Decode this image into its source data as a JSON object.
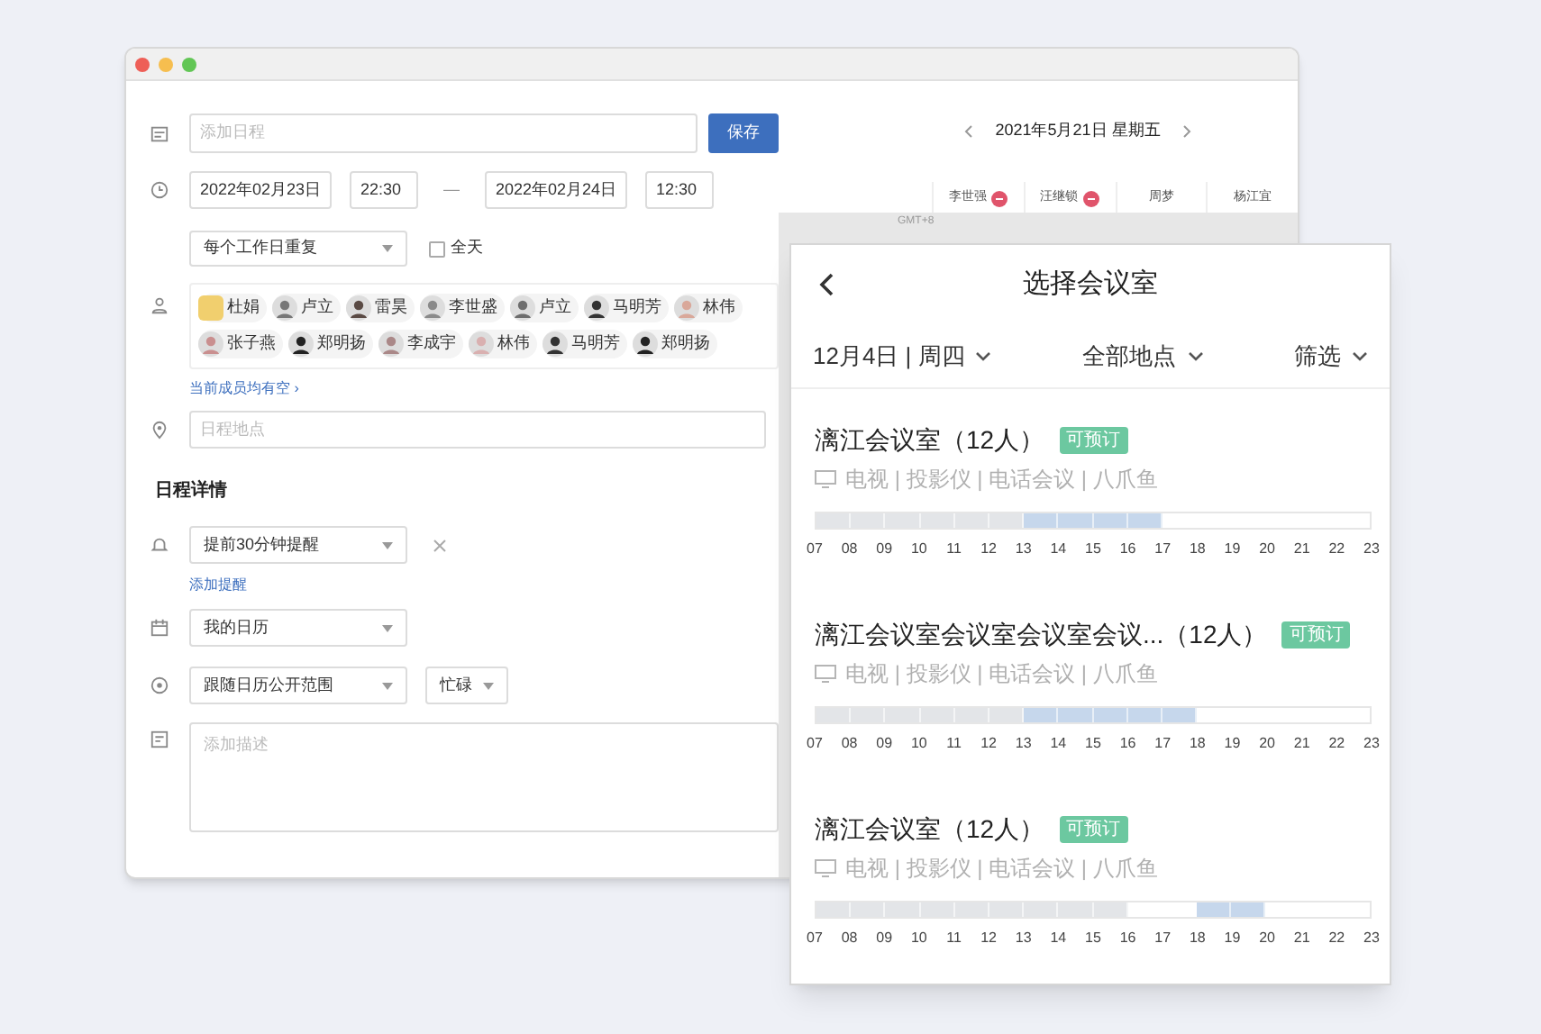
{
  "form": {
    "title_placeholder": "添加日程",
    "save_button": "保存",
    "start_date": "2022年02月23日",
    "start_time": "22:30",
    "dash": "—",
    "end_date": "2022年02月24日",
    "end_time": "12:30",
    "repeat": "每个工作日重复",
    "all_day": {
      "label": "全天",
      "checked": false
    },
    "attendees": [
      {
        "name": "杜娟",
        "kind": "square"
      },
      {
        "name": "卢立",
        "kind": "round"
      },
      {
        "name": "雷昊",
        "kind": "round"
      },
      {
        "name": "李世盛",
        "kind": "round"
      },
      {
        "name": "卢立",
        "kind": "round"
      },
      {
        "name": "马明芳",
        "kind": "round"
      },
      {
        "name": "林伟",
        "kind": "round"
      },
      {
        "name": "张子燕",
        "kind": "round"
      },
      {
        "name": "郑明扬",
        "kind": "round"
      },
      {
        "name": "李成宇",
        "kind": "round"
      },
      {
        "name": "林伟",
        "kind": "round"
      },
      {
        "name": "马明芳",
        "kind": "round"
      },
      {
        "name": "郑明扬",
        "kind": "round"
      }
    ],
    "availability_link": "当前成员均有空 ›",
    "location_placeholder": "日程地点",
    "section_title": "日程详情",
    "reminder": "提前30分钟提醒",
    "add_reminder": "添加提醒",
    "calendar": "我的日历",
    "visibility": "跟随日历公开范围",
    "busy": "忙碌",
    "description_placeholder": "添加描述"
  },
  "schedule": {
    "date": "2021年5月21日 星期五",
    "people": [
      {
        "name": "李世强",
        "flagged": true
      },
      {
        "name": "汪继锁",
        "flagged": true
      },
      {
        "name": "周梦",
        "flagged": false
      },
      {
        "name": "杨江宜",
        "flagged": false
      }
    ],
    "timezone": "GMT+8"
  },
  "room_picker": {
    "title": "选择会议室",
    "filters": [
      "12月4日 | 周四",
      "全部地点",
      "筛选"
    ],
    "rooms": [
      {
        "name": "漓江会议室（12人）",
        "badge": "可预订",
        "amenities": "电视 | 投影仪 | 电话会议 | 八爪鱼",
        "slots": [
          {
            "kind": "past"
          },
          {
            "kind": "past"
          },
          {
            "kind": "past"
          },
          {
            "kind": "past"
          },
          {
            "kind": "past"
          },
          {
            "kind": "past"
          },
          {
            "kind": "booked"
          },
          {
            "kind": "booked"
          },
          {
            "kind": "booked"
          },
          {
            "kind": "booked"
          },
          {
            "kind": "free"
          },
          {
            "kind": "free"
          },
          {
            "kind": "free"
          },
          {
            "kind": "free"
          },
          {
            "kind": "free"
          },
          {
            "kind": "free"
          }
        ],
        "hours": [
          "07",
          "08",
          "09",
          "10",
          "11",
          "12",
          "13",
          "14",
          "15",
          "16",
          "17",
          "18",
          "19",
          "20",
          "21",
          "22",
          "23"
        ]
      },
      {
        "name": "漓江会议室会议室会议室会议...（12人）",
        "badge": "可预订",
        "amenities": "电视 | 投影仪 | 电话会议 | 八爪鱼",
        "slots": [
          {
            "kind": "past"
          },
          {
            "kind": "past"
          },
          {
            "kind": "past"
          },
          {
            "kind": "past"
          },
          {
            "kind": "past"
          },
          {
            "kind": "past"
          },
          {
            "kind": "booked"
          },
          {
            "kind": "booked"
          },
          {
            "kind": "booked"
          },
          {
            "kind": "booked"
          },
          {
            "kind": "booked"
          },
          {
            "kind": "free"
          },
          {
            "kind": "free"
          },
          {
            "kind": "free"
          },
          {
            "kind": "free"
          },
          {
            "kind": "free"
          }
        ],
        "hours": [
          "07",
          "08",
          "09",
          "10",
          "11",
          "12",
          "13",
          "14",
          "15",
          "16",
          "17",
          "18",
          "19",
          "20",
          "21",
          "22",
          "23"
        ]
      },
      {
        "name": "漓江会议室（12人）",
        "badge": "可预订",
        "amenities": "电视 | 投影仪 | 电话会议 | 八爪鱼",
        "slots": [
          {
            "kind": "past"
          },
          {
            "kind": "past"
          },
          {
            "kind": "past"
          },
          {
            "kind": "past"
          },
          {
            "kind": "past"
          },
          {
            "kind": "past"
          },
          {
            "kind": "past"
          },
          {
            "kind": "past"
          },
          {
            "kind": "past"
          },
          {
            "kind": "free"
          },
          {
            "kind": "free"
          },
          {
            "kind": "booked"
          },
          {
            "kind": "booked"
          },
          {
            "kind": "free"
          },
          {
            "kind": "free"
          },
          {
            "kind": "free"
          }
        ],
        "hours": [
          "07",
          "08",
          "09",
          "10",
          "11",
          "12",
          "13",
          "14",
          "15",
          "16",
          "17",
          "18",
          "19",
          "20",
          "21",
          "22",
          "23"
        ]
      }
    ]
  }
}
